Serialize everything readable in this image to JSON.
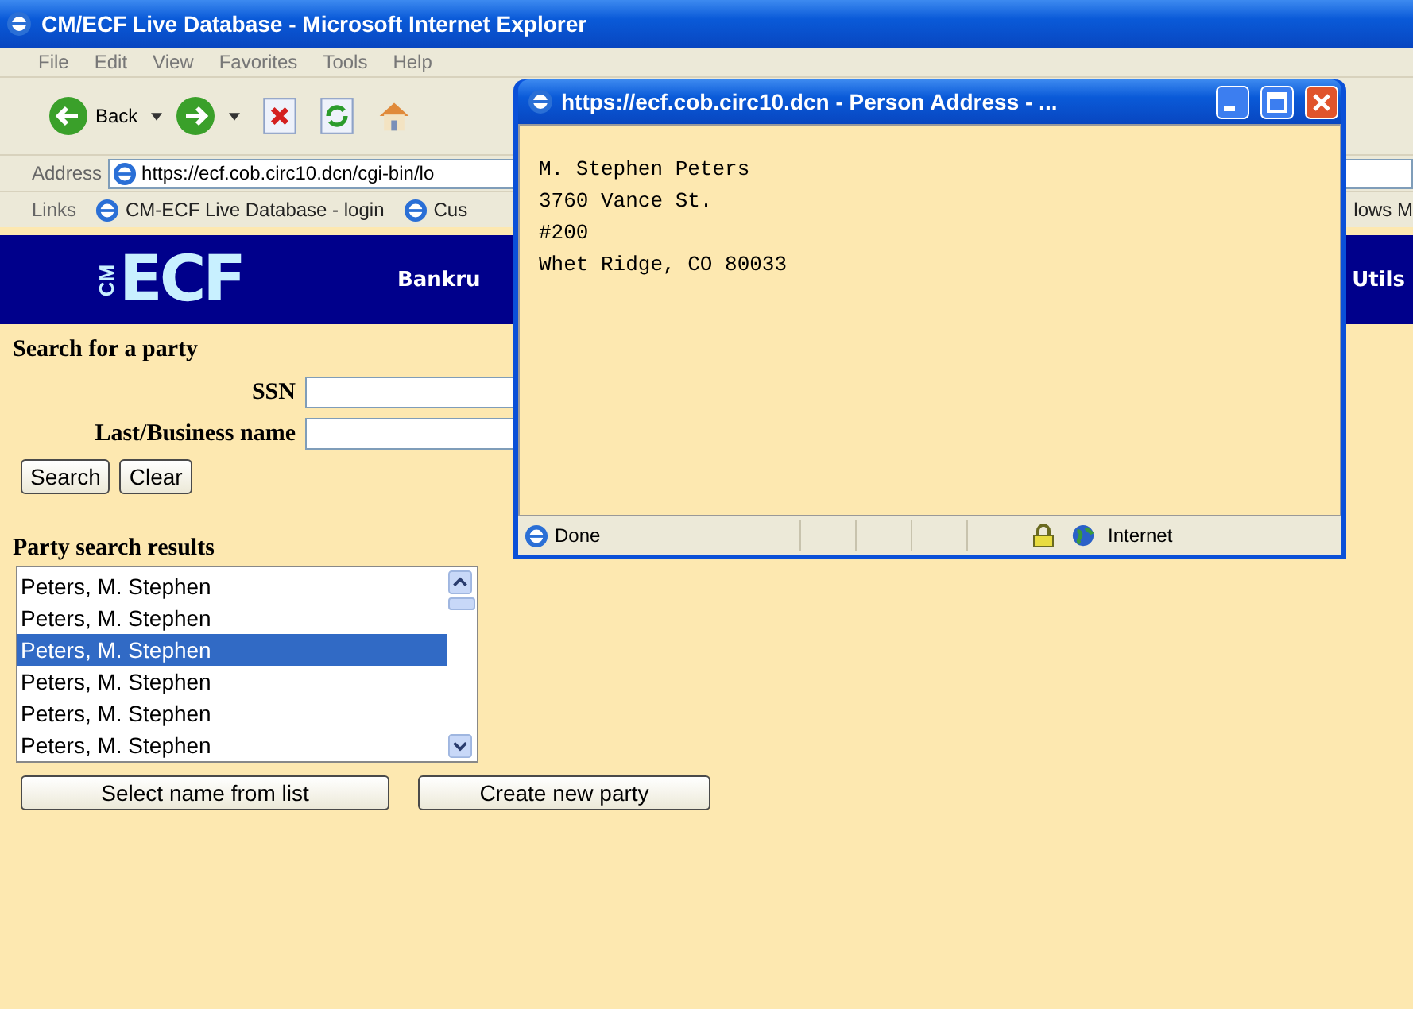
{
  "window": {
    "title": "CM/ECF Live Database - Microsoft Internet Explorer"
  },
  "menu": [
    "File",
    "Edit",
    "View",
    "Favorites",
    "Tools",
    "Help"
  ],
  "toolbar": {
    "back_label": "Back"
  },
  "address_bar": {
    "label": "Address",
    "value": "https://ecf.cob.circ10.dcn/cgi-bin/lo"
  },
  "links_bar": {
    "label": "Links",
    "links": [
      "CM-ECF Live Database - login",
      "Cus"
    ],
    "overflow": "lows M"
  },
  "banner": {
    "logo_small": "CM",
    "logo_main": "ECF",
    "menu": [
      "Bankru",
      "Utils"
    ]
  },
  "search": {
    "heading": "Search for a party",
    "fields": [
      {
        "label": "SSN"
      },
      {
        "label": "Last/Business name"
      }
    ],
    "buttons": [
      "Search",
      "Clear"
    ]
  },
  "results": {
    "heading": "Party search results",
    "items": [
      {
        "name": "Peters, M. Stephen",
        "selected": false
      },
      {
        "name": "Peters, M. Stephen",
        "selected": false
      },
      {
        "name": "Peters, M. Stephen",
        "selected": true
      },
      {
        "name": "Peters, M. Stephen",
        "selected": false
      },
      {
        "name": "Peters, M. Stephen",
        "selected": false
      },
      {
        "name": "Peters, M. Stephen",
        "selected": false
      }
    ],
    "buttons": [
      "Select name from list",
      "Create new party"
    ]
  },
  "popup": {
    "title": "https://ecf.cob.circ10.dcn - Person Address - ...",
    "lines": [
      "M. Stephen Peters",
      "3760 Vance St.",
      "#200",
      "Whet Ridge, CO 80033"
    ],
    "status": "Done",
    "zone": "Internet"
  }
}
